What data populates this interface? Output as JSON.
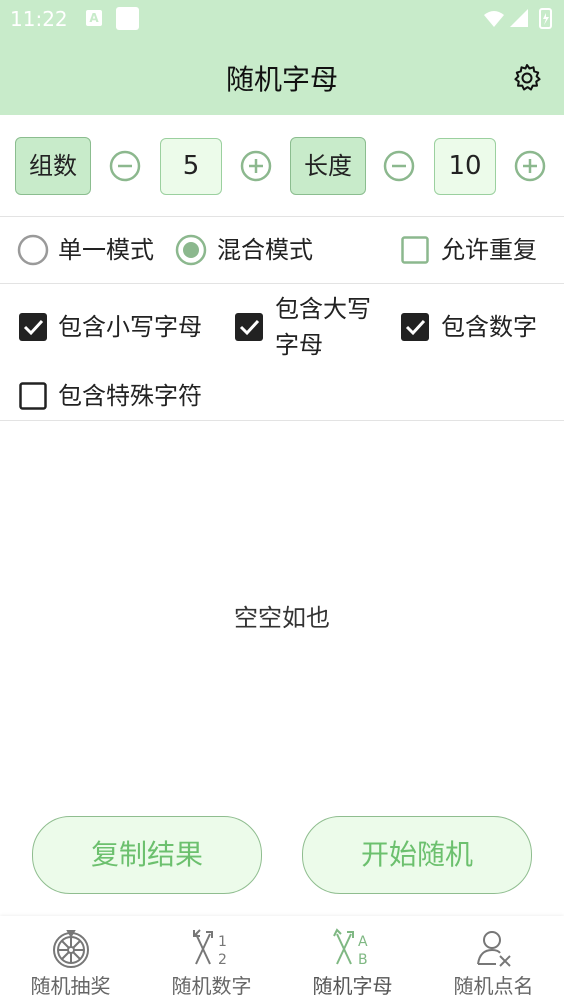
{
  "status_bar": {
    "time": "11:22",
    "a_badge": "A"
  },
  "app_bar": {
    "title": "随机字母"
  },
  "controls": {
    "groups_label": "组数",
    "groups_value": "5",
    "length_label": "长度",
    "length_value": "10"
  },
  "modes": {
    "single": "单一模式",
    "mixed": "混合模式",
    "mixed_selected": true,
    "allow_repeat": "允许重复",
    "allow_repeat_checked": false
  },
  "options": {
    "lowercase": "包含小写字母",
    "lowercase_checked": true,
    "uppercase_line1": "包含大写",
    "uppercase_line2": "字母",
    "uppercase_checked": true,
    "digits": "包含数字",
    "digits_checked": true,
    "special": "包含特殊字符",
    "special_checked": false
  },
  "result": {
    "empty_text": "空空如也"
  },
  "actions": {
    "copy": "复制结果",
    "start": "开始随机"
  },
  "nav": {
    "items": [
      {
        "label": "随机抽奖",
        "icon": "wheel-icon"
      },
      {
        "label": "随机数字",
        "icon": "random-number-icon"
      },
      {
        "label": "随机字母",
        "icon": "random-letter-icon",
        "active": true
      },
      {
        "label": "随机点名",
        "icon": "roll-call-icon"
      }
    ]
  },
  "colors": {
    "accent": "#c8ebca",
    "button_text": "#6cc06e",
    "button_bg": "#ecfbea"
  }
}
